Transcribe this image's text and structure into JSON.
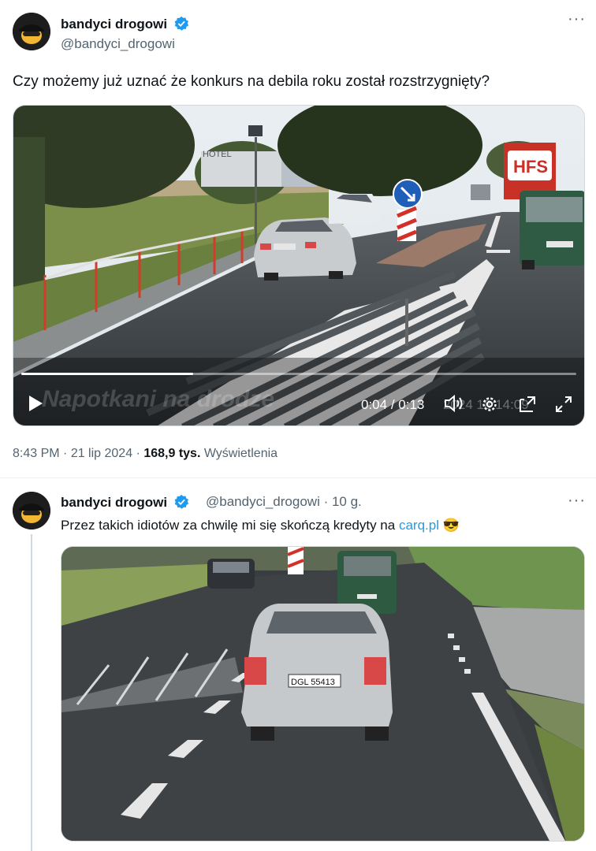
{
  "tweet": {
    "author_name": "bandyci drogowi",
    "author_handle": "@bandyci_drogowi",
    "verified_icon": "verified-badge-icon",
    "more_label": "···",
    "text": "Czy możemy już uznać że konkurs na debila roku został rozstrzygnięty?",
    "video": {
      "current_time": "0:04",
      "separator": " / ",
      "duration": "0:13",
      "progress": 0.31,
      "watermark": "Napotkani na drodze",
      "timestamp_overlay": "2024 18:14:09",
      "sign_text": "HOTEL",
      "truck_logo": "HFS",
      "icons": [
        "play-icon",
        "volume-icon",
        "settings-icon",
        "pip-icon",
        "fullscreen-icon"
      ]
    },
    "time": "8:43 PM",
    "dot1": " · ",
    "date": "21 lip 2024",
    "dot2": " · ",
    "views_count": "168,9 tys.",
    "views_label": " Wyświetlenia"
  },
  "reply": {
    "author_name": "bandyci drogowi",
    "author_handle": "@bandyci_drogowi",
    "age": "· 10 g.",
    "more_label": "···",
    "text_before": "Przez takich idiotów za chwilę mi się skończą kredyty na ",
    "link_text": "carq.pl",
    "emoji": "😎",
    "plate_text": "DGL 55413"
  },
  "colors": {
    "link": "#1d9bf0",
    "verified": "#1d9bf0",
    "secondary_text": "#536471"
  }
}
